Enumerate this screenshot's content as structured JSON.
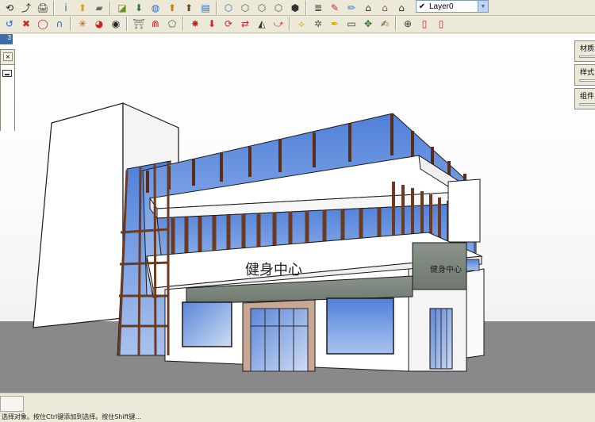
{
  "toolbar": {
    "layer_select": {
      "value": "Layer0",
      "checked_glyph": "✔"
    },
    "tools_row1": [
      {
        "name": "orbit-icon",
        "glyph": "⟲",
        "color": "#1a1a1a"
      },
      {
        "name": "pan-icon",
        "glyph": "⤴",
        "color": "#2b2b2b"
      },
      {
        "name": "print-icon",
        "glyph": "🖨",
        "color": "#444"
      },
      {
        "name": "info-icon",
        "glyph": "i",
        "color": "#1f5fc8"
      },
      {
        "name": "export-icon",
        "glyph": "⬆",
        "color": "#d7a400"
      },
      {
        "name": "paint-icon",
        "glyph": "▰",
        "color": "#6a6a6a"
      },
      {
        "name": "component-icon",
        "glyph": "◪",
        "color": "#6b8e23"
      },
      {
        "name": "move-down-icon",
        "glyph": "⬇",
        "color": "#2a7a2a"
      },
      {
        "name": "sphere-icon",
        "glyph": "◍",
        "color": "#2d6fc2"
      },
      {
        "name": "import-icon",
        "glyph": "⬆",
        "color": "#c97a00"
      },
      {
        "name": "share-icon",
        "glyph": "⬆",
        "color": "#6a4a1a"
      },
      {
        "name": "stack-icon",
        "glyph": "▤",
        "color": "#2d6fc2"
      },
      {
        "name": "box-iso-icon",
        "glyph": "⬡",
        "color": "#3c6fb5"
      },
      {
        "name": "box-front-icon",
        "glyph": "⬡",
        "color": "#555"
      },
      {
        "name": "box-top-icon",
        "glyph": "⬡",
        "color": "#555"
      },
      {
        "name": "box-right-icon",
        "glyph": "⬡",
        "color": "#555"
      },
      {
        "name": "box-back-icon",
        "glyph": "⬢",
        "color": "#333"
      },
      {
        "name": "layers-icon",
        "glyph": "≣",
        "color": "#333"
      },
      {
        "name": "red-brush-icon",
        "glyph": "✎",
        "color": "#c62828"
      },
      {
        "name": "pencil-icon",
        "glyph": "✏",
        "color": "#2d6fc2"
      },
      {
        "name": "house-icon",
        "glyph": "⌂",
        "color": "#333"
      },
      {
        "name": "house-tall-icon",
        "glyph": "⌂",
        "color": "#8a5a2a"
      },
      {
        "name": "house-small-icon",
        "glyph": "⌂",
        "color": "#333"
      },
      {
        "name": "more-icon",
        "glyph": "⌂",
        "color": "#333"
      }
    ],
    "tools_row2": [
      {
        "name": "rotate-arc-icon",
        "glyph": "↺",
        "color": "#1f5fc8"
      },
      {
        "name": "follow-me-icon",
        "glyph": "✖",
        "color": "#c62828"
      },
      {
        "name": "ellipse-icon",
        "glyph": "◯",
        "color": "#c62828"
      },
      {
        "name": "arch-icon",
        "glyph": "∩",
        "color": "#1f5fc8"
      },
      {
        "name": "snowflake-icon",
        "glyph": "✳",
        "color": "#d04a02"
      },
      {
        "name": "pie-icon",
        "glyph": "◕",
        "color": "#c62828"
      },
      {
        "name": "wheel-icon",
        "glyph": "◉",
        "color": "#222"
      },
      {
        "name": "arch-gate-icon",
        "glyph": "⛩",
        "color": "#6a6a6a"
      },
      {
        "name": "magnet-icon",
        "glyph": "⋒",
        "color": "#c62828"
      },
      {
        "name": "house-green-icon",
        "glyph": "⬠",
        "color": "#2a7a2a"
      },
      {
        "name": "star-red-icon",
        "glyph": "✸",
        "color": "#c62828"
      },
      {
        "name": "push-pull-icon",
        "glyph": "⬇",
        "color": "#c62828"
      },
      {
        "name": "cycle-icon",
        "glyph": "⟳",
        "color": "#c62828"
      },
      {
        "name": "flip-icon",
        "glyph": "⇄",
        "color": "#c62828"
      },
      {
        "name": "mirror-icon",
        "glyph": "◭",
        "color": "#333"
      },
      {
        "name": "curl-icon",
        "glyph": "⤻",
        "color": "#c62828"
      },
      {
        "name": "axes-icon",
        "glyph": "⟡",
        "color": "#d7a400"
      },
      {
        "name": "sparkle-icon",
        "glyph": "✲",
        "color": "#555"
      },
      {
        "name": "feather-icon",
        "glyph": "✒",
        "color": "#d7a400"
      },
      {
        "name": "label-icon",
        "glyph": "▭",
        "color": "#333"
      },
      {
        "name": "cross-arrows-icon",
        "glyph": "✥",
        "color": "#2a7a2a"
      },
      {
        "name": "pen-tool-icon",
        "glyph": "✍",
        "color": "#6a4a1a"
      },
      {
        "name": "compass-icon",
        "glyph": "⊕",
        "color": "#333"
      },
      {
        "name": "red-doc-icon",
        "glyph": "▯",
        "color": "#c62828"
      },
      {
        "name": "red-doc2-icon",
        "glyph": "▯",
        "color": "#c62828"
      }
    ]
  },
  "viewport": {
    "sign_main": "健身中心",
    "sign_side": "健身中心",
    "colors": {
      "sky": "#ffffff",
      "ground": "#898989",
      "glass": "#5b84d6",
      "mullion": "#6b3a22",
      "wall": "#ffffff",
      "sign_band": "#7f8a7f"
    }
  },
  "tray": {
    "tabs": [
      {
        "label": "材质"
      },
      {
        "label": "样式"
      },
      {
        "label": "组件"
      }
    ]
  },
  "left_panel": {
    "tab_label": "3"
  },
  "status": {
    "hint": "选择对象。按住Ctrl键添加到选择。按住Shift键..."
  }
}
